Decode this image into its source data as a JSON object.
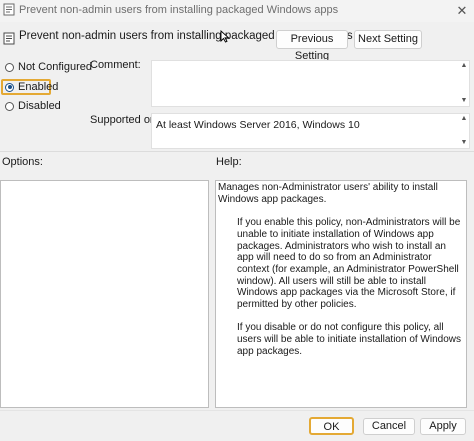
{
  "window": {
    "title": "Prevent non-admin users from installing packaged Windows apps",
    "close_glyph": "✕"
  },
  "header": {
    "policy_title": "Prevent non-admin users from installing packaged Windows apps",
    "previous_setting_label": "Previous Setting",
    "next_setting_label": "Next Setting"
  },
  "state": {
    "options": [
      {
        "label": "Not Configured",
        "selected": false
      },
      {
        "label": "Enabled",
        "selected": true
      },
      {
        "label": "Disabled",
        "selected": false
      }
    ]
  },
  "comment": {
    "label": "Comment:",
    "value": ""
  },
  "supported_on": {
    "label": "Supported on:",
    "value": "At least Windows Server 2016, Windows 10"
  },
  "options_section": {
    "label": "Options:"
  },
  "help_section": {
    "label": "Help:",
    "paragraphs": [
      "Manages non-Administrator users' ability to install Windows app packages.",
      "If you enable this policy, non-Administrators will be unable to initiate installation of Windows app packages. Administrators who wish to install an app will need to do so from an Administrator context (for example, an Administrator PowerShell window). All users will still be able to install Windows app packages via the Microsoft Store, if permitted by other policies.",
      "If you disable or do not configure this policy, all users will be able to initiate installation of Windows app packages."
    ]
  },
  "footer": {
    "ok_label": "OK",
    "cancel_label": "Cancel",
    "apply_label": "Apply"
  },
  "colors": {
    "highlight_border": "#e4a934",
    "radio_selected": "#1a4f8a"
  },
  "icons": {
    "app_icon": "policy-document-icon",
    "close": "close-icon",
    "cursor": "mouse-pointer-icon"
  }
}
